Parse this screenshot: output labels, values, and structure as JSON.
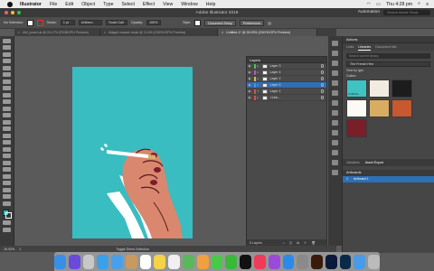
{
  "menubar": {
    "app_name": "Illustrator",
    "items": [
      "File",
      "Edit",
      "Object",
      "Type",
      "Select",
      "Effect",
      "View",
      "Window",
      "Help"
    ],
    "time": "Thu 4:28 pm"
  },
  "window": {
    "title": "Adobe Illustrator 2019",
    "workspace": "Automation",
    "search_placeholder": "Search Adobe Stock"
  },
  "control": {
    "selection": "No Selection",
    "stroke_label": "Stroke:",
    "stroke_value": "1 pt",
    "stroke_style": "Uniform",
    "brush": "Touch Call",
    "opacity_label": "Opacity:",
    "opacity_value": "100%",
    "style_label": "Style:",
    "doc_setup": "Document Setup",
    "preferences": "Preferences"
  },
  "tabs": [
    {
      "label": "AM_poverLai @ 24.17% (RGB/GPU Preview)",
      "active": false
    },
    {
      "label": "Abigail mosser vecal @ 3.14% (CMYK/GPU Preview)",
      "active": false
    },
    {
      "label": "Untitled-1* @ 26.93% (CMYK/GPU Preview)",
      "active": true
    }
  ],
  "status": {
    "zoom": "26.93%",
    "artboard_num": "1",
    "tool": "Toggle Direct Selection"
  },
  "layers": {
    "title": "Layers",
    "rows": [
      {
        "name": "Layer 3",
        "color": "#4fc24f",
        "expanded": false,
        "selected": false
      },
      {
        "name": "Layer 4",
        "color": "#c24fc2",
        "expanded": false,
        "selected": false
      },
      {
        "name": "Layer 2",
        "color": "#c2c24f",
        "expanded": false,
        "selected": false
      },
      {
        "name": "Layer 5",
        "color": "#4f8fd8",
        "expanded": false,
        "selected": true
      },
      {
        "name": "Layer 1",
        "color": "#d84f4f",
        "expanded": true,
        "selected": false
      },
      {
        "name": "<Link...",
        "color": "#d84f4f",
        "expanded": false,
        "selected": false
      }
    ],
    "footer": "5 Layers"
  },
  "right": {
    "actions_tab": "Actions",
    "subtabs": [
      "Links",
      "Libraries",
      "Document Info"
    ],
    "active_subtab": "Libraries",
    "search_placeholder": "Search current library",
    "library": "The French Hen",
    "view_by": "View by type",
    "colors_label": "Colors",
    "swatches": [
      {
        "hex": "#3ec2c2",
        "label": "C=69 M..."
      },
      {
        "hex": "#f1ebe1",
        "label": ""
      },
      {
        "hex": "#1c1c1c",
        "label": ""
      },
      {
        "hex": "#fbfaf5",
        "label": ""
      },
      {
        "hex": "#d8ad62",
        "label": ""
      },
      {
        "hex": "#c85830",
        "label": ""
      },
      {
        "hex": "#7a1e2a",
        "label": ""
      }
    ],
    "variables_tab": "Variables",
    "asset_export_tab": "Asset Export",
    "artboards_title": "Artboards",
    "artboard_num": "1",
    "artboard_name": "Artboard 1"
  },
  "dock": [
    "Finder",
    "Siri",
    "Launchpad",
    "Safari",
    "Mail",
    "Contacts",
    "Calendar",
    "Notes",
    "Reminders",
    "Maps",
    "Photos",
    "Messages",
    "FaceTime",
    "TV",
    "Music",
    "Podcasts",
    "App Store",
    "System Preferences",
    "Illustrator",
    "Photoshop",
    "Lightroom",
    "Folder",
    "Trash"
  ]
}
